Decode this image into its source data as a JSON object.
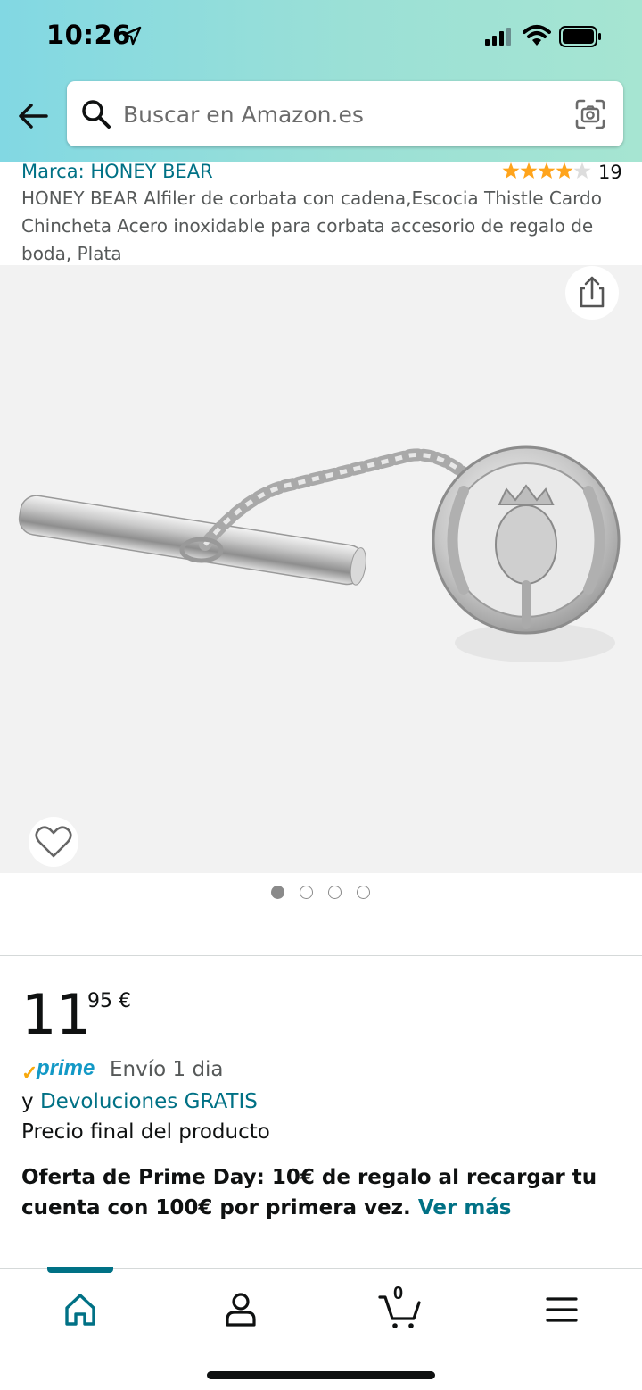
{
  "status_bar": {
    "time": "10:26",
    "icons": [
      "location-arrow-icon",
      "signal-icon",
      "wifi-icon",
      "battery-icon"
    ]
  },
  "header": {
    "back_icon": "back-arrow-icon",
    "search_placeholder": "Buscar en Amazon.es",
    "search_value": "",
    "camera_icon": "camera-search-icon"
  },
  "product": {
    "brand": "Marca: HONEY BEAR",
    "rating_stars": 4,
    "rating_count": "19",
    "title": "HONEY BEAR Alfiler de corbata con cadena,Escocia Thistle Cardo Chincheta Acero inoxidable para corbata accesorio de regalo de boda,  Plata"
  },
  "gallery": {
    "image_count": 4,
    "active_index": 0,
    "share_icon": "share-icon",
    "favorite_icon": "heart-icon"
  },
  "price": {
    "whole": "11",
    "fraction": "95 €",
    "prime_label": "prime",
    "delivery": "Envío 1 dia",
    "returns_prefix": "y",
    "returns_link": "Devoluciones GRATIS",
    "final_price_note": "Precio final del producto"
  },
  "offer": {
    "text": "Oferta de Prime Day: 10€ de regalo al recargar tu cuenta con 100€ por primera vez.",
    "link": "Ver más"
  },
  "tabbar": {
    "tabs": [
      "home-icon",
      "profile-icon",
      "cart-icon",
      "menu-icon"
    ],
    "active": "home",
    "cart_count": "0"
  },
  "colors": {
    "link": "#007185",
    "prime_blue": "#1399c6",
    "star": "#ffa41c",
    "header_gradient_start": "#82d8e3",
    "header_gradient_end": "#a6e5d2"
  }
}
